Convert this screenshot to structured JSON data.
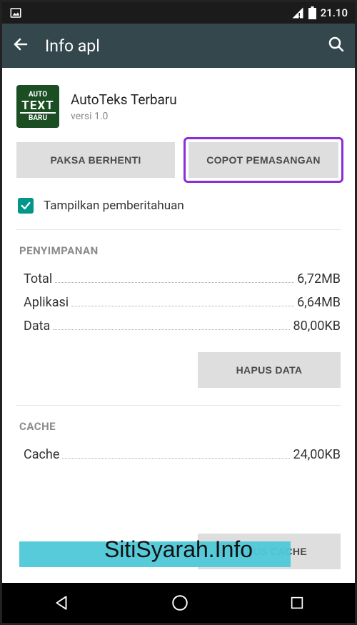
{
  "statusbar": {
    "time": "21.10"
  },
  "toolbar": {
    "title": "Info apl"
  },
  "app": {
    "icon_line1": "AUTO",
    "icon_line2": "TEXT",
    "icon_line3": "BARU",
    "name": "AutoTeks Terbaru",
    "version": "versi 1.0"
  },
  "buttons": {
    "force_stop": "PAKSA BERHENTI",
    "uninstall": "COPOT PEMASANGAN",
    "clear_data": "HAPUS DATA",
    "clear_cache": "HAPUS CACHE"
  },
  "checkbox": {
    "label": "Tampilkan pemberitahuan",
    "checked": true
  },
  "sections": {
    "storage": {
      "title": "PENYIMPANAN",
      "rows": [
        {
          "label": "Total",
          "value": "6,72MB"
        },
        {
          "label": "Aplikasi",
          "value": "6,64MB"
        },
        {
          "label": "Data",
          "value": "80,00KB"
        }
      ]
    },
    "cache": {
      "title": "CACHE",
      "rows": [
        {
          "label": "Cache",
          "value": "24,00KB"
        }
      ]
    }
  },
  "watermark": "SitiSyarah.Info"
}
